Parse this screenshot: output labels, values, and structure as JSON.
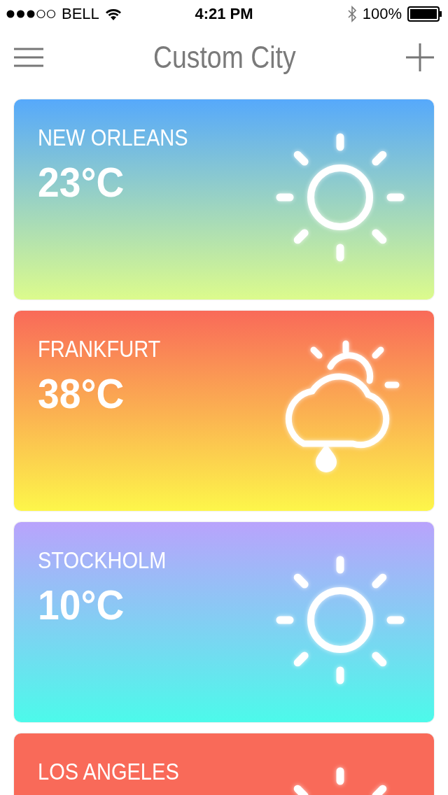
{
  "status_bar": {
    "carrier": "BELL",
    "time": "4:21 PM",
    "battery": "100%"
  },
  "nav_bar": {
    "title": "Custom City"
  },
  "cards": [
    {
      "city": "NEW ORLEANS",
      "temperature": "23°C",
      "kind": "sunny",
      "gradient": [
        {
          "color": "#56a9fb"
        },
        {
          "color": "#dcfb8c"
        }
      ]
    },
    {
      "city": "FRANKFURT",
      "temperature": "38°C",
      "kind": "rain",
      "gradient": [
        {
          "color": "#f96a59"
        },
        {
          "color": "#fdf64a"
        }
      ]
    },
    {
      "city": "STOCKHOLM",
      "temperature": "10°C",
      "kind": "sunny",
      "gradient": [
        {
          "color": "#b9a3fc"
        },
        {
          "color": "#4cfaea"
        }
      ]
    },
    {
      "city": "LOS ANGELES",
      "kind": "sunny",
      "gradient": [
        {
          "color": "#f96a59"
        }
      ]
    }
  ]
}
